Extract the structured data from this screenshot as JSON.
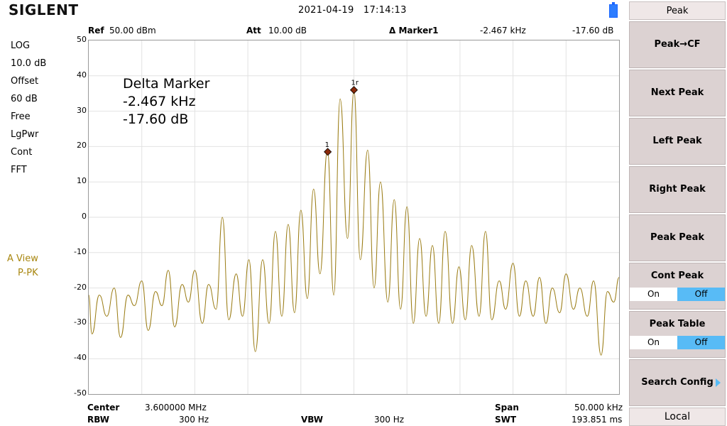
{
  "header": {
    "logo": "SIGLENT",
    "date": "2021-04-19",
    "time": "17:14:13"
  },
  "left_panel": {
    "items": [
      "LOG",
      "10.0 dB",
      "Offset",
      "60 dB",
      "Free",
      "LgPwr",
      "Cont",
      "FFT"
    ],
    "trace_label": "A View",
    "trace_mode": "P-PK"
  },
  "plot_header": {
    "ref_label": "Ref",
    "ref_value": "50.00 dBm",
    "att_label": "Att",
    "att_value": "10.00 dB",
    "marker_label": "Δ Marker1",
    "marker_freq": "-2.467 kHz",
    "marker_amp": "-17.60 dB"
  },
  "annotation": {
    "title": "Delta Marker",
    "freq": "-2.467 kHz",
    "amp": "-17.60 dB"
  },
  "markers": [
    {
      "label": "1",
      "x_khz": -2.467,
      "y_db": 18.5
    },
    {
      "label": "1r",
      "x_khz": 0.0,
      "y_db": 36.0
    }
  ],
  "chart_data": {
    "type": "line",
    "y_ticks": [
      "50",
      "40",
      "30",
      "20",
      "10",
      "0",
      "-10",
      "-20",
      "-30",
      "-40",
      "-50"
    ],
    "ylim": [
      -50,
      50
    ],
    "xlim_khz": [
      -25,
      25
    ],
    "grid": true,
    "trace_color": "#9a7c14",
    "peaks": [
      {
        "x": -24.0,
        "y": -22
      },
      {
        "x": -22.6,
        "y": -20
      },
      {
        "x": -21.3,
        "y": -22
      },
      {
        "x": -20.0,
        "y": -18
      },
      {
        "x": -18.7,
        "y": -21
      },
      {
        "x": -17.5,
        "y": -15
      },
      {
        "x": -16.2,
        "y": -19
      },
      {
        "x": -15.0,
        "y": -15
      },
      {
        "x": -13.7,
        "y": -19
      },
      {
        "x": -12.4,
        "y": 0
      },
      {
        "x": -11.1,
        "y": -16
      },
      {
        "x": -9.9,
        "y": -12
      },
      {
        "x": -8.6,
        "y": -12
      },
      {
        "x": -7.4,
        "y": -4
      },
      {
        "x": -6.2,
        "y": -2
      },
      {
        "x": -5.0,
        "y": 2
      },
      {
        "x": -3.8,
        "y": 8
      },
      {
        "x": -2.5,
        "y": 19
      },
      {
        "x": -1.3,
        "y": 33.5
      },
      {
        "x": 0.0,
        "y": 36
      },
      {
        "x": 1.3,
        "y": 19
      },
      {
        "x": 2.5,
        "y": 10
      },
      {
        "x": 3.8,
        "y": 5
      },
      {
        "x": 5.0,
        "y": 3
      },
      {
        "x": 6.2,
        "y": -6
      },
      {
        "x": 7.4,
        "y": -8
      },
      {
        "x": 8.6,
        "y": -4
      },
      {
        "x": 9.9,
        "y": -14
      },
      {
        "x": 11.1,
        "y": -8
      },
      {
        "x": 12.4,
        "y": -4
      },
      {
        "x": 13.7,
        "y": -18
      },
      {
        "x": 15.0,
        "y": -13
      },
      {
        "x": 16.2,
        "y": -18
      },
      {
        "x": 17.5,
        "y": -17
      },
      {
        "x": 18.7,
        "y": -20
      },
      {
        "x": 20.0,
        "y": -16
      },
      {
        "x": 21.3,
        "y": -20
      },
      {
        "x": 22.6,
        "y": -18
      },
      {
        "x": 23.9,
        "y": -21
      },
      {
        "x": 25.0,
        "y": -17
      }
    ],
    "valleys": [
      {
        "x": -24.7,
        "y": -33
      },
      {
        "x": -23.3,
        "y": -28
      },
      {
        "x": -22.0,
        "y": -34
      },
      {
        "x": -20.7,
        "y": -25
      },
      {
        "x": -19.4,
        "y": -32
      },
      {
        "x": -18.1,
        "y": -25
      },
      {
        "x": -16.9,
        "y": -31
      },
      {
        "x": -15.6,
        "y": -24
      },
      {
        "x": -14.3,
        "y": -30
      },
      {
        "x": -13.0,
        "y": -26
      },
      {
        "x": -11.8,
        "y": -29
      },
      {
        "x": -10.5,
        "y": -28
      },
      {
        "x": -9.3,
        "y": -38
      },
      {
        "x": -8.0,
        "y": -30
      },
      {
        "x": -6.8,
        "y": -28
      },
      {
        "x": -5.6,
        "y": -27
      },
      {
        "x": -4.4,
        "y": -23
      },
      {
        "x": -3.2,
        "y": -16
      },
      {
        "x": -1.9,
        "y": -22
      },
      {
        "x": -0.6,
        "y": -6
      },
      {
        "x": 0.6,
        "y": -12
      },
      {
        "x": 1.9,
        "y": -20
      },
      {
        "x": 3.2,
        "y": -24
      },
      {
        "x": 4.4,
        "y": -26
      },
      {
        "x": 5.6,
        "y": -30
      },
      {
        "x": 6.8,
        "y": -28
      },
      {
        "x": 8.0,
        "y": -30
      },
      {
        "x": 9.3,
        "y": -30
      },
      {
        "x": 10.5,
        "y": -29
      },
      {
        "x": 11.8,
        "y": -28
      },
      {
        "x": 13.0,
        "y": -29
      },
      {
        "x": 14.3,
        "y": -26
      },
      {
        "x": 15.6,
        "y": -28
      },
      {
        "x": 16.9,
        "y": -28
      },
      {
        "x": 18.1,
        "y": -30
      },
      {
        "x": 19.4,
        "y": -27
      },
      {
        "x": 20.7,
        "y": -26
      },
      {
        "x": 22.0,
        "y": -28
      },
      {
        "x": 23.3,
        "y": -39
      },
      {
        "x": 24.5,
        "y": -24
      }
    ]
  },
  "bottom_bar": {
    "center_label": "Center",
    "center_value": "3.600000 MHz",
    "rbw_label": "RBW",
    "rbw_value": "300 Hz",
    "vbw_label": "VBW",
    "vbw_value": "300 Hz",
    "span_label": "Span",
    "span_value": "50.000 kHz",
    "swt_label": "SWT",
    "swt_value": "193.851 ms"
  },
  "softkeys": {
    "title": "Peak",
    "items": [
      "Peak→CF",
      "Next Peak",
      "Left Peak",
      "Right Peak",
      "Peak Peak"
    ],
    "cont_peak": {
      "label": "Cont Peak",
      "on": "On",
      "off": "Off"
    },
    "peak_table": {
      "label": "Peak Table",
      "on": "On",
      "off": "Off"
    },
    "search_config": "Search Config",
    "local": "Local"
  },
  "colors": {
    "trace": "#9a7c14",
    "marker": "#8a2a0a",
    "toggle_active": "#58bbf6",
    "softkey_bg": "#dcd2d2"
  }
}
